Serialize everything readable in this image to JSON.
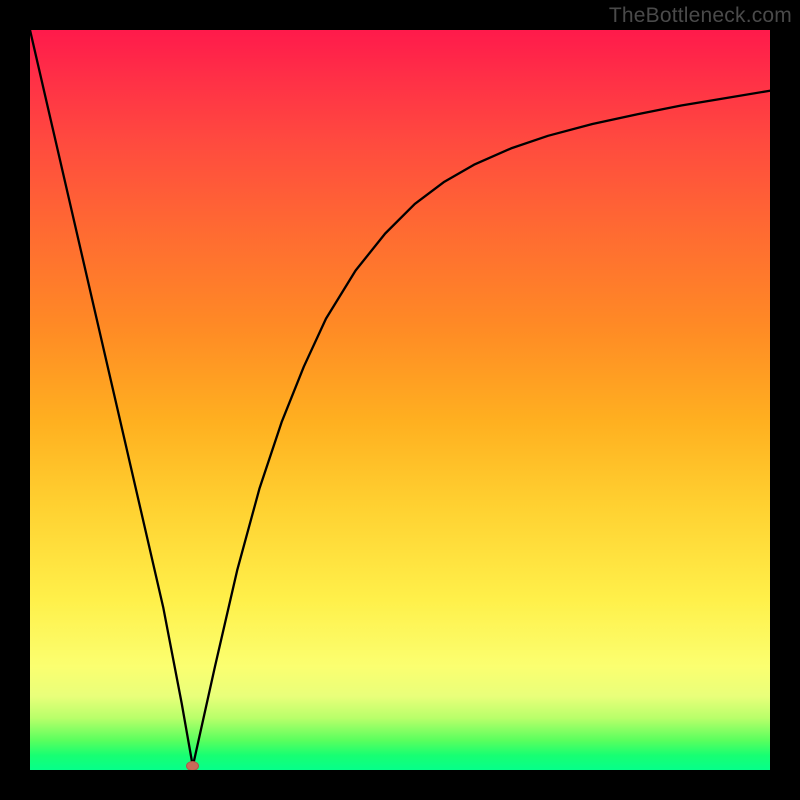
{
  "watermark": "TheBottleneck.com",
  "marker": {
    "x_frac": 0.22,
    "y_frac": 0.994
  },
  "chart_data": {
    "type": "line",
    "title": "",
    "xlabel": "",
    "ylabel": "",
    "xlim": [
      0,
      1
    ],
    "ylim": [
      0,
      1
    ],
    "background_gradient": {
      "direction": "vertical",
      "stops": [
        {
          "pos": 0.0,
          "color": "#ff1a4b"
        },
        {
          "pos": 0.5,
          "color": "#ffa020"
        },
        {
          "pos": 0.8,
          "color": "#fff04a"
        },
        {
          "pos": 0.96,
          "color": "#5aff5e"
        },
        {
          "pos": 1.0,
          "color": "#06ff8a"
        }
      ]
    },
    "series": [
      {
        "name": "left-descent",
        "x": [
          0.0,
          0.03,
          0.06,
          0.09,
          0.12,
          0.15,
          0.18,
          0.205,
          0.22
        ],
        "y": [
          1.0,
          0.87,
          0.74,
          0.61,
          0.48,
          0.35,
          0.22,
          0.09,
          0.005
        ]
      },
      {
        "name": "right-ascent",
        "x": [
          0.22,
          0.25,
          0.28,
          0.31,
          0.34,
          0.37,
          0.4,
          0.44,
          0.48,
          0.52,
          0.56,
          0.6,
          0.65,
          0.7,
          0.76,
          0.82,
          0.88,
          0.94,
          1.0
        ],
        "y": [
          0.005,
          0.14,
          0.27,
          0.38,
          0.47,
          0.545,
          0.61,
          0.675,
          0.725,
          0.765,
          0.795,
          0.818,
          0.84,
          0.857,
          0.873,
          0.886,
          0.898,
          0.908,
          0.918
        ]
      }
    ],
    "marker": {
      "x": 0.22,
      "y": 0.006,
      "shape": "oval",
      "color": "#c96a59"
    }
  }
}
